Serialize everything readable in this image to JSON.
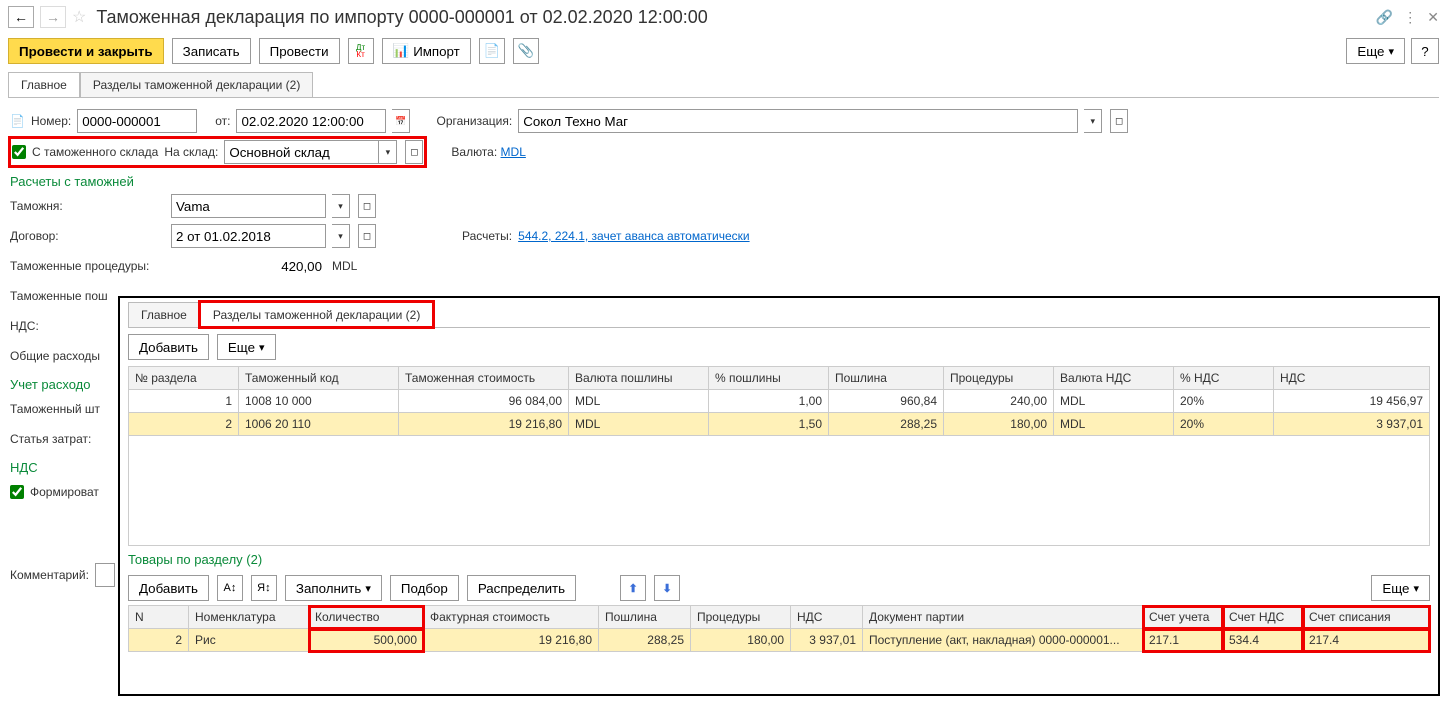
{
  "header": {
    "title": "Таможенная декларация по импорту 0000-000001 от 02.02.2020 12:00:00"
  },
  "toolbar": {
    "post_close": "Провести и закрыть",
    "write": "Записать",
    "post": "Провести",
    "import": "Импорт",
    "more": "Еще",
    "help": "?"
  },
  "tabs": {
    "main": "Главное",
    "sections": "Разделы таможенной декларации (2)"
  },
  "main": {
    "number_label": "Номер:",
    "number": "0000-000001",
    "date_label": "от:",
    "date": "02.02.2020 12:00:00",
    "org_label": "Организация:",
    "org": "Сокол Техно Маг",
    "from_bonded_label": "С таможенного склада",
    "to_warehouse_label": "На склад:",
    "warehouse": "Основной склад",
    "currency_label": "Валюта:",
    "currency_link": "MDL"
  },
  "customs": {
    "header": "Расчеты с таможней",
    "customs_label": "Таможня:",
    "customs": "Vama",
    "contract_label": "Договор:",
    "contract": "2 от 01.02.2018",
    "settlements_label": "Расчеты:",
    "settlements_link": "544.2, 224.1, зачет аванса автоматически",
    "procedures_label": "Таможенные процедуры:",
    "procedures_amount": "420,00",
    "procedures_currency": "MDL",
    "fees_label": "Таможенные пош",
    "vat_label": "НДС:",
    "general_label": "Общие расходы"
  },
  "expenses": {
    "header": "Учет расходо",
    "fine_label": "Таможенный шт",
    "cost_item_label": "Статья затрат:"
  },
  "vat_section": {
    "header": "НДС",
    "form_label": "Формироват"
  },
  "comment_label": "Комментарий:",
  "overlay": {
    "tabs": {
      "main": "Главное",
      "sections": "Разделы таможенной декларации (2)"
    },
    "add_btn": "Добавить",
    "more_btn": "Еще",
    "fill_btn": "Заполнить",
    "select_btn": "Подбор",
    "distribute_btn": "Распределить",
    "goods_header": "Товары по разделу  (2)"
  },
  "sections_table": {
    "headers": [
      "№ раздела",
      "Таможенный код",
      "Таможенная стоимость",
      "Валюта пошлины",
      "% пошлины",
      "Пошлина",
      "Процедуры",
      "Валюта НДС",
      "% НДС",
      "НДС"
    ],
    "rows": [
      {
        "n": "1",
        "code": "1008 10 000",
        "cost": "96 084,00",
        "dutycur": "MDL",
        "dutypct": "1,00",
        "duty": "960,84",
        "proc": "240,00",
        "vatcur": "MDL",
        "vatpct": "20%",
        "vat": "19 456,97"
      },
      {
        "n": "2",
        "code": "1006 20 110",
        "cost": "19 216,80",
        "dutycur": "MDL",
        "dutypct": "1,50",
        "duty": "288,25",
        "proc": "180,00",
        "vatcur": "MDL",
        "vatpct": "20%",
        "vat": "3 937,01"
      }
    ]
  },
  "goods_table": {
    "headers": [
      "N",
      "Номенклатура",
      "Количество",
      "Фактурная стоимость",
      "Пошлина",
      "Процедуры",
      "НДС",
      "Документ партии",
      "Счет учета",
      "Счет НДС",
      "Счет списания"
    ],
    "row": {
      "n": "2",
      "name": "Рис",
      "qty": "500,000",
      "cost": "19 216,80",
      "duty": "288,25",
      "proc": "180,00",
      "vat": "3 937,01",
      "doc": "Поступление (акт, накладная) 0000-000001...",
      "acc": "217.1",
      "vatacc": "534.4",
      "writeoff": "217.4"
    }
  }
}
